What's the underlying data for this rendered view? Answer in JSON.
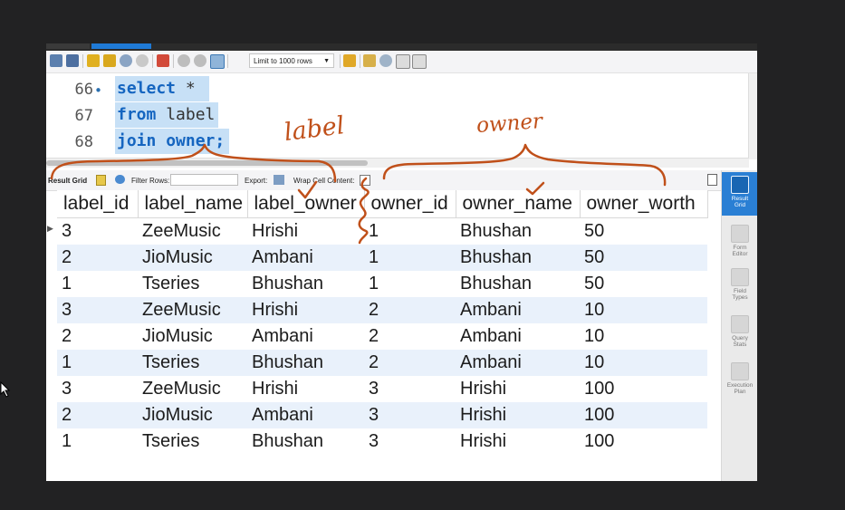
{
  "toolbar": {
    "limit_label": "Limit to 1000 rows"
  },
  "editor": {
    "lines": [
      {
        "num": "66",
        "bullet": "•",
        "keyword": "select",
        "rest": " *"
      },
      {
        "num": "67",
        "bullet": "",
        "keyword": "from",
        "rest": " label"
      },
      {
        "num": "68",
        "bullet": "",
        "keyword": "join",
        "rest": " owner;"
      }
    ]
  },
  "result_bar": {
    "result_grid": "Result Grid",
    "filter_rows": "Filter Rows:",
    "export": "Export:",
    "wrap_cell": "Wrap Cell Content:"
  },
  "grid": {
    "columns": [
      "label_id",
      "label_name",
      "label_owner",
      "owner_id",
      "owner_name",
      "owner_worth"
    ],
    "rows": [
      [
        "3",
        "ZeeMusic",
        "Hrishi",
        "1",
        "Bhushan",
        "50"
      ],
      [
        "2",
        "JioMusic",
        "Ambani",
        "1",
        "Bhushan",
        "50"
      ],
      [
        "1",
        "Tseries",
        "Bhushan",
        "1",
        "Bhushan",
        "50"
      ],
      [
        "3",
        "ZeeMusic",
        "Hrishi",
        "2",
        "Ambani",
        "10"
      ],
      [
        "2",
        "JioMusic",
        "Ambani",
        "2",
        "Ambani",
        "10"
      ],
      [
        "1",
        "Tseries",
        "Bhushan",
        "2",
        "Ambani",
        "10"
      ],
      [
        "3",
        "ZeeMusic",
        "Hrishi",
        "3",
        "Hrishi",
        "100"
      ],
      [
        "2",
        "JioMusic",
        "Ambani",
        "3",
        "Hrishi",
        "100"
      ],
      [
        "1",
        "Tseries",
        "Bhushan",
        "3",
        "Hrishi",
        "100"
      ]
    ]
  },
  "side_panel": [
    {
      "label": "Result\nGrid",
      "active": true
    },
    {
      "label": "Form\nEditor",
      "active": false
    },
    {
      "label": "Field\nTypes",
      "active": false
    },
    {
      "label": "Query\nStats",
      "active": false
    },
    {
      "label": "Execution\nPlan",
      "active": false
    }
  ],
  "annotations": {
    "label_note": "label",
    "owner_note": "owner",
    "ink_color": "#c0501a"
  },
  "colors": {
    "keyword": "#1565c0",
    "selection": "#c7e0f6",
    "active_tab": "#2a7fd4"
  }
}
